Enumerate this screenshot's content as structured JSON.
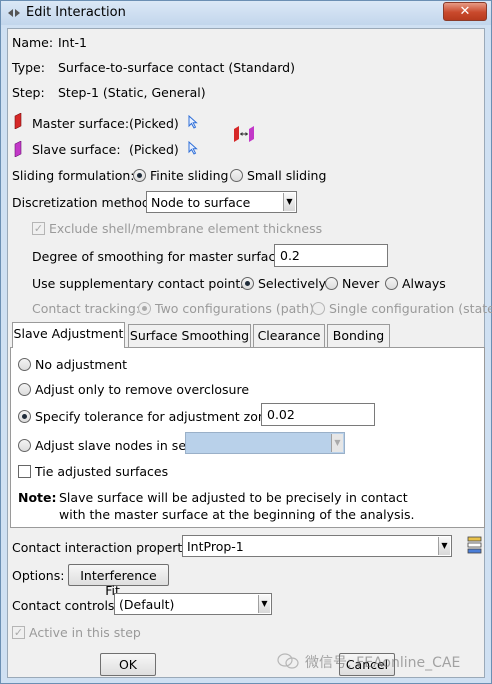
{
  "window": {
    "title": "Edit Interaction",
    "close_glyph": "✕"
  },
  "info": {
    "name_label": "Name:",
    "name_value": "Int-1",
    "type_label": "Type:",
    "type_value": "Surface-to-surface contact (Standard)",
    "step_label": "Step:",
    "step_value": "Step-1 (Static, General)"
  },
  "surfaces": {
    "master_label": "Master surface:",
    "master_value": "(Picked)",
    "slave_label": "Slave surface:",
    "slave_value": "(Picked)",
    "master_color": "#d62828",
    "slave_color": "#c238c8"
  },
  "sliding": {
    "label": "Sliding formulation:",
    "options": [
      "Finite sliding",
      "Small sliding"
    ],
    "selected": "Finite sliding"
  },
  "discretization": {
    "label": "Discretization method:",
    "value": "Node to surface"
  },
  "exclude_thickness": {
    "label": "Exclude shell/membrane element thickness",
    "checked": true,
    "enabled": false
  },
  "smoothing": {
    "label": "Degree of smoothing for master surface:",
    "value": "0.2"
  },
  "supplementary": {
    "label": "Use supplementary contact points:",
    "options": [
      "Selectively",
      "Never",
      "Always"
    ],
    "selected": "Selectively"
  },
  "tracking": {
    "label": "Contact tracking:",
    "options": [
      "Two configurations (path)",
      "Single configuration (state)"
    ],
    "selected": "Two configurations (path)",
    "enabled": false
  },
  "tabs": [
    "Slave Adjustment",
    "Surface Smoothing",
    "Clearance",
    "Bonding"
  ],
  "active_tab": "Slave Adjustment",
  "slave_adjustment": {
    "options": [
      "No adjustment",
      "Adjust only to remove overclosure",
      "Specify tolerance for adjustment zone:",
      "Adjust slave nodes in set:"
    ],
    "selected": "Specify tolerance for adjustment zone:",
    "tolerance_value": "0.02",
    "tie_label": "Tie adjusted surfaces",
    "tie_checked": false,
    "note_label": "Note:",
    "note_line1": "Slave surface will be adjusted to be precisely in contact",
    "note_line2": "with the master surface at the beginning of the analysis."
  },
  "property": {
    "label": "Contact interaction property:",
    "value": "IntProp-1"
  },
  "options_row": {
    "label": "Options:",
    "button": "Interference Fit..."
  },
  "controls": {
    "label": "Contact controls:",
    "value": "(Default)"
  },
  "active_step": {
    "label": "Active in this step",
    "checked": true,
    "enabled": false
  },
  "buttons": {
    "ok": "OK",
    "cancel": "Cancel"
  },
  "watermark": {
    "text": "微信号: FEAonline_CAE"
  }
}
